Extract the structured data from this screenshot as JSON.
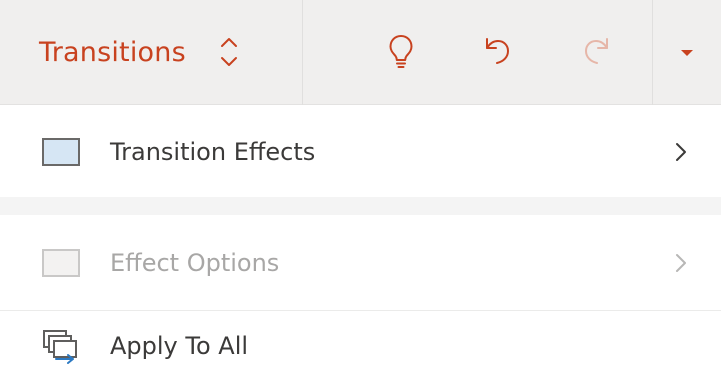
{
  "toolbar": {
    "tab_title": "Transitions",
    "icons": {
      "tab_switcher": "chevron-up-down-icon",
      "tell_me": "lightbulb-icon",
      "undo": "undo-icon",
      "redo": "redo-icon",
      "more": "caret-down-icon"
    }
  },
  "menu": {
    "items": [
      {
        "label": "Transition Effects",
        "enabled": true,
        "has_submenu": true
      },
      {
        "label": "Effect Options",
        "enabled": false,
        "has_submenu": true
      },
      {
        "label": "Apply To All",
        "enabled": true,
        "has_submenu": false
      }
    ]
  },
  "colors": {
    "accent": "#c8421f",
    "toolbar_bg": "#f0efee",
    "text": "#3b3a39",
    "disabled_text": "#a8a7a6",
    "swatch_fill": "#d6e6f4",
    "apply_icon_accent": "#2b79c2"
  }
}
